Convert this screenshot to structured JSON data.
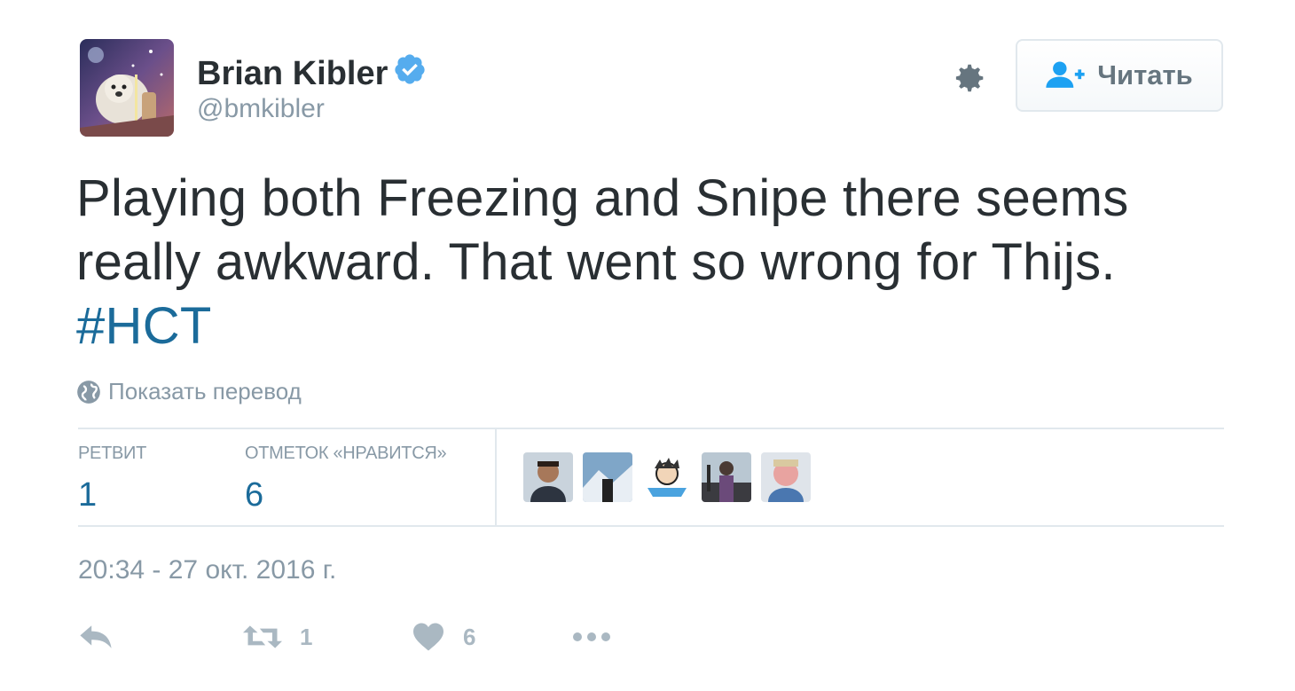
{
  "author": {
    "display_name": "Brian Kibler",
    "handle": "@bmkibler",
    "verified": true
  },
  "header": {
    "follow_label": "Читать"
  },
  "tweet": {
    "text_main": "Playing both Freezing and Snipe there seems really awkward. That went so wrong for Thijs.",
    "hashtag": "#HCT",
    "translate_label": "Показать перевод"
  },
  "stats": {
    "retweets_label": "РЕТВИТ",
    "retweets_value": "1",
    "likes_label": "ОТМЕТОК «НРАВИТСЯ»",
    "likes_value": "6"
  },
  "likers_count_shown": 5,
  "timestamp": "20:34 - 27 окт. 2016 г.",
  "actions": {
    "reply_icon": "reply-icon",
    "retweet_icon": "retweet-icon",
    "retweet_count": "1",
    "like_icon": "heart-icon",
    "like_count": "6",
    "more_icon": "more-icon"
  },
  "colors": {
    "link": "#1b6b9a",
    "muted": "#8899a6",
    "verified": "#55acee",
    "follow_icon": "#1da1f2",
    "action_icon": "#aab8c2"
  }
}
